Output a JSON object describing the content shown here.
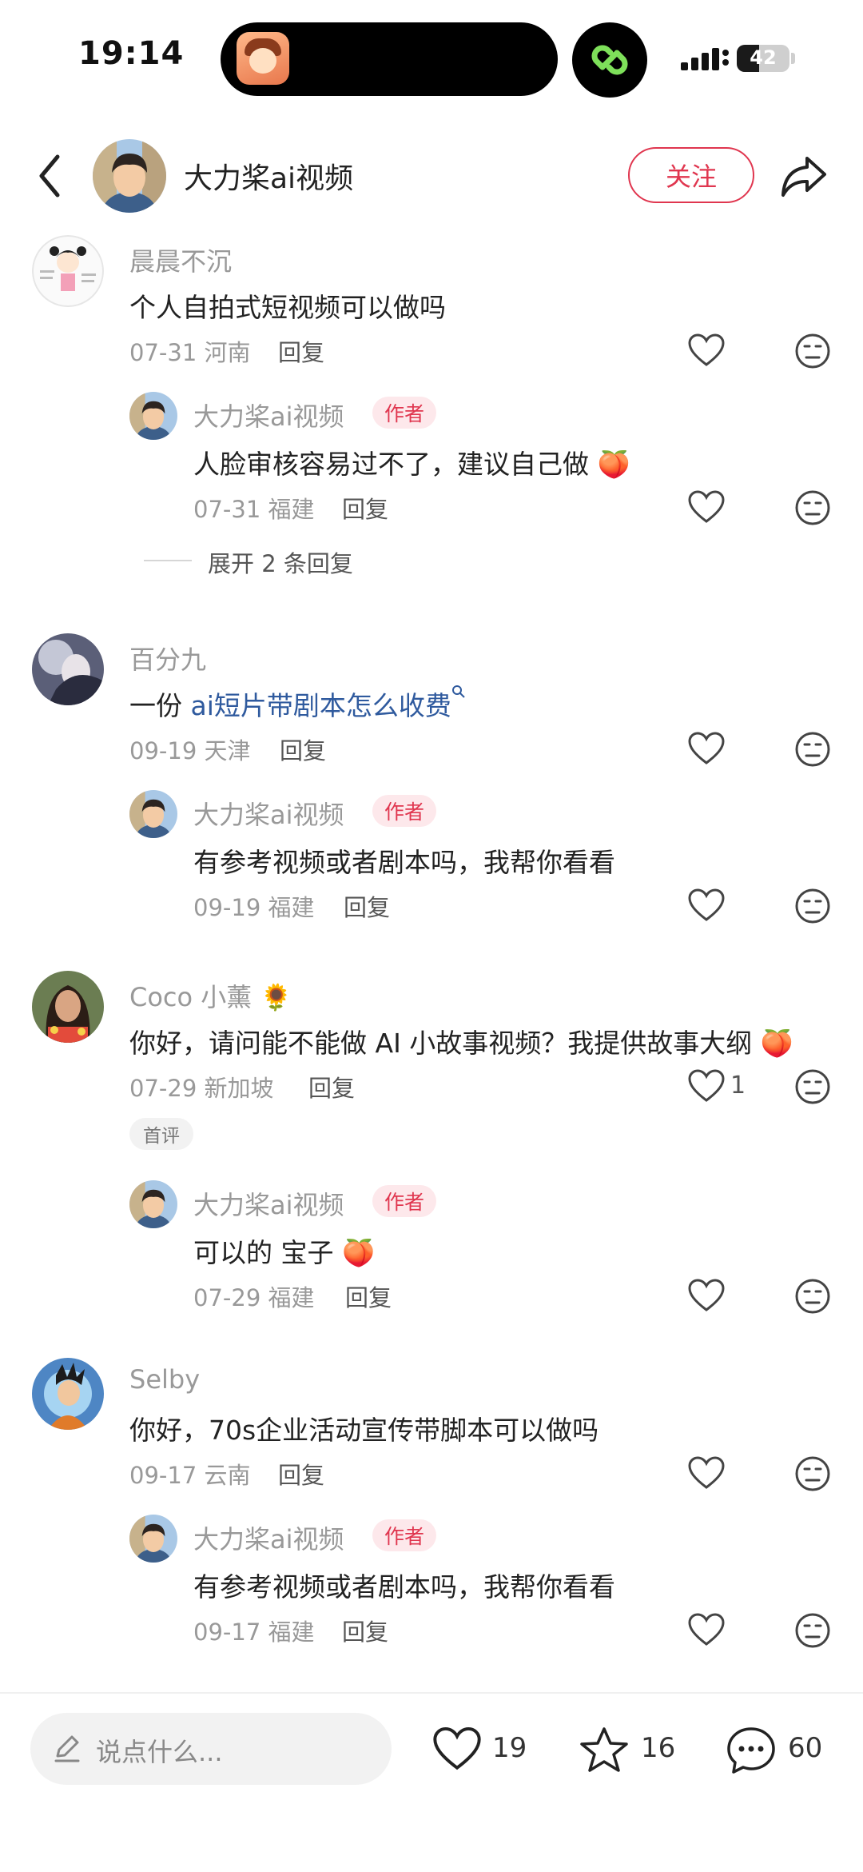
{
  "status_bar": {
    "time": "19:14",
    "battery": "42",
    "battery_level": 0.42
  },
  "header": {
    "back_label": "back",
    "name": "大力桨ai视频",
    "follow_label": "关注"
  },
  "comments": [
    {
      "name": "晨晨不沉",
      "text": "个人自拍式短视频可以做吗",
      "meta": "07-31 河南",
      "reply_label": "回复",
      "likes": "",
      "reply": {
        "name": "大力桨ai视频",
        "badge": "作者",
        "text": "人脸审核容易过不了，建议自己做",
        "meta": "07-31 福建",
        "reply_label": "回复"
      },
      "expand": "展开 2 条回复"
    },
    {
      "name": "百分九",
      "text_prefix": "一份 ",
      "text_link": "ai短片带剧本怎么收费",
      "meta": "09-19 天津",
      "reply_label": "回复",
      "reply": {
        "name": "大力桨ai视频",
        "badge": "作者",
        "text": "有参考视频或者剧本吗，我帮你看看",
        "meta": "09-19 福建",
        "reply_label": "回复"
      }
    },
    {
      "name": "Coco 小薰",
      "text": "你好，请问能不能做 AI 小故事视频？我提供故事大纲",
      "meta": "07-29 新加坡",
      "reply_label": "回复",
      "likes": "1",
      "tag": "首评",
      "reply": {
        "name": "大力桨ai视频",
        "badge": "作者",
        "text": "可以的 宝子",
        "meta": "07-29 福建",
        "reply_label": "回复"
      }
    },
    {
      "name": "Selby",
      "text": "你好，70s企业活动宣传带脚本可以做吗",
      "meta": "09-17 云南",
      "reply_label": "回复",
      "reply": {
        "name": "大力桨ai视频",
        "badge": "作者",
        "text": "有参考视频或者剧本吗，我帮你看看",
        "meta": "09-17 福建",
        "reply_label": "回复"
      }
    }
  ],
  "bottom_bar": {
    "input_placeholder": "说点什么...",
    "likes": "19",
    "stars": "16",
    "comments": "60"
  },
  "colors": {
    "accent": "#e0364f",
    "link": "#2f5a9e",
    "muted": "#999999"
  },
  "icons": [
    "back-icon",
    "share-icon",
    "heart-icon",
    "dislike-icon",
    "star-icon",
    "comment-icon",
    "pencil-icon",
    "search-icon"
  ]
}
